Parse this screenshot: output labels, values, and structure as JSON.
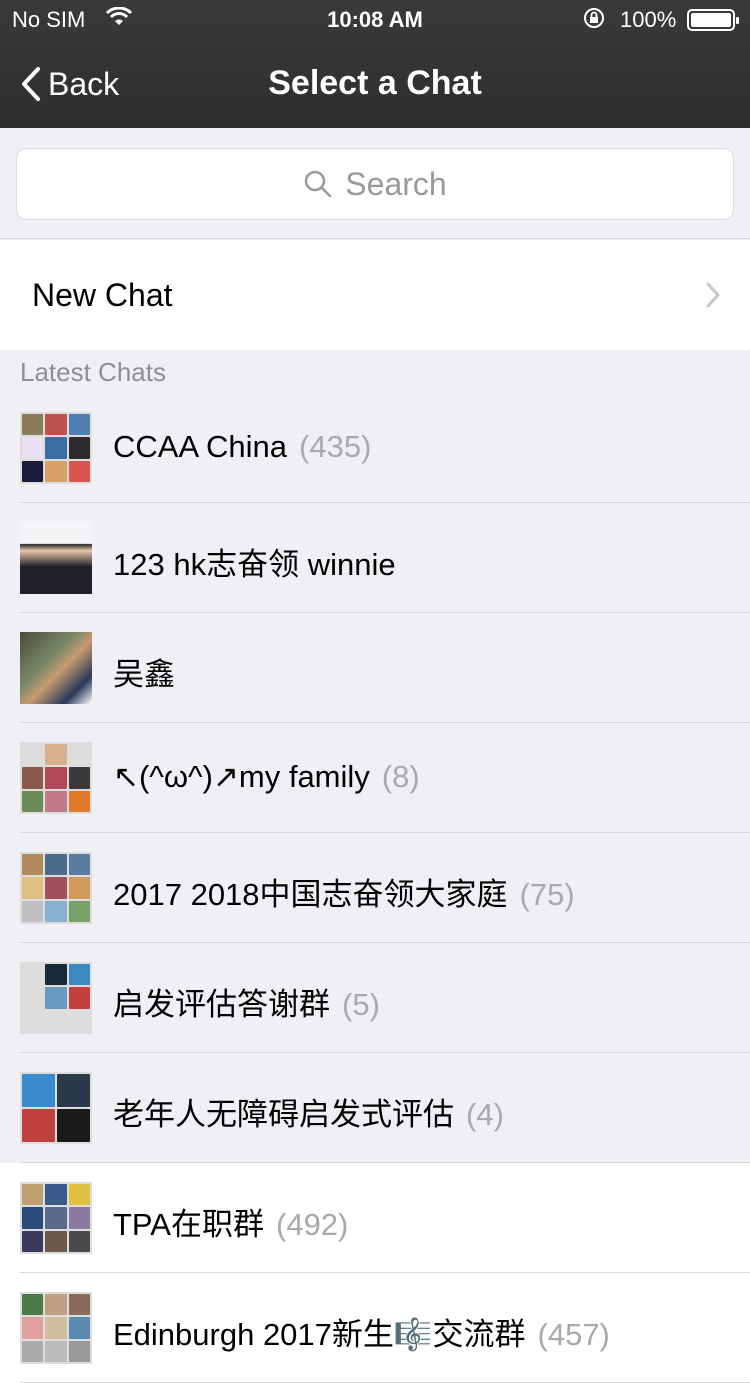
{
  "status_bar": {
    "carrier": "No SIM",
    "time": "10:08 AM",
    "battery": "100%"
  },
  "nav": {
    "back_label": "Back",
    "title": "Select a Chat"
  },
  "search": {
    "placeholder": "Search"
  },
  "new_chat": {
    "label": "New Chat"
  },
  "section": {
    "latest_chats": "Latest Chats"
  },
  "chats": [
    {
      "name": "CCAA China",
      "count": "(435)"
    },
    {
      "name": "123 hk志奋领  winnie",
      "count": ""
    },
    {
      "name": "吴鑫",
      "count": ""
    },
    {
      "name": "↖(^ω^)↗my  family",
      "count": "(8)"
    },
    {
      "name": "2017 2018中国志奋领大家庭",
      "count": "(75)"
    },
    {
      "name": "启发评估答谢群",
      "count": "(5)"
    },
    {
      "name": "老年人无障碍启发式评估",
      "count": "(4)"
    },
    {
      "name": "TPA在职群",
      "count": "(492)"
    },
    {
      "name": "Edinburgh 2017新生🎼交流群",
      "count": "(457)"
    }
  ],
  "colors": {
    "header_bg": "#333335",
    "list_bg": "#efeff4",
    "count_text": "#a8a8ae"
  }
}
